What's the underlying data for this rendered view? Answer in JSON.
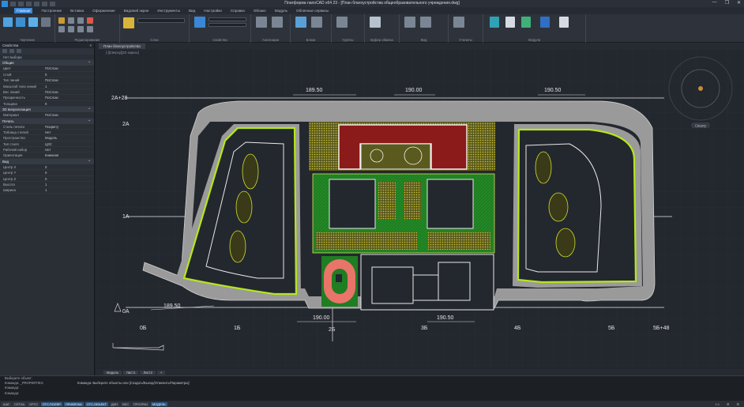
{
  "app": {
    "title": "Платформа nanoCAD x64 23 - [План благоустройства общеобразовательного учреждения.dwg]",
    "window_controls": [
      "—",
      "❐",
      "✕"
    ]
  },
  "ribbon_tabs": [
    "Главная",
    "Построение",
    "Вставка",
    "Оформление",
    "Видовой экран",
    "Инструменты",
    "Вид",
    "Настройки",
    "Справка",
    "Облако",
    "Модуль",
    "Облачные сервисы"
  ],
  "ribbon_groups": [
    "Черчение",
    "Редактирование",
    "Слои",
    "Свойства",
    "Аннотации",
    "Блоки",
    "Группы",
    "Буфер обмена",
    "Вид",
    "Утилиты",
    "Модули"
  ],
  "properties": {
    "panel_title": "Свойства",
    "selection": "Нет выбора",
    "sections": [
      {
        "title": "Общие",
        "rows": [
          [
            "Цвет",
            "ПоСлою"
          ],
          [
            "Слой",
            "0"
          ],
          [
            "Тип линий",
            "ПоСлою"
          ],
          [
            "Масштаб типа линий",
            "1"
          ],
          [
            "Вес линий",
            "ПоСлою"
          ],
          [
            "Прозрачность",
            "ПоСлою"
          ],
          [
            "Толщина",
            "0"
          ]
        ]
      },
      {
        "title": "3D визуализация",
        "rows": [
          [
            "Материал",
            "ПоСлою"
          ]
        ]
      },
      {
        "title": "Печать",
        "rows": [
          [
            "Стиль печати",
            "ПоЦвету"
          ],
          [
            "Таблица стилей",
            "Нет"
          ],
          [
            "Пространство",
            "Модель"
          ],
          [
            "Тип стиля",
            "ЦЗС"
          ],
          [
            "Рабочий набор",
            "Нет"
          ],
          [
            "Ориентация",
            "Книжная"
          ]
        ]
      },
      {
        "title": "Вид",
        "rows": [
          [
            "Центр X",
            "0"
          ],
          [
            "Центр Y",
            "0"
          ],
          [
            "Центр Z",
            "0"
          ],
          [
            "Высота",
            "1"
          ],
          [
            "Ширина",
            "1"
          ]
        ]
      }
    ]
  },
  "document_tab": "План благоустройства",
  "view_label": "[-][Сверху][2D каркас]",
  "drawing": {
    "row_labels": [
      "2А+28",
      "2А",
      "1А",
      "0А"
    ],
    "column_labels": [
      "0Б",
      "1Б",
      "2Б",
      "3Б",
      "4Б",
      "5Б",
      "5Б+48"
    ],
    "dimensions": [
      "189.50",
      "190.00",
      "190.50",
      "189.50",
      "190.00",
      "190.50"
    ],
    "colors": {
      "road": "#9a9a9a",
      "grass": "#b5e61d",
      "field": "#1e7b24",
      "building": "#8b1a1a",
      "track": "#e8746a",
      "sand": "#b8a624"
    }
  },
  "viewcube_label": "Сверху",
  "layout_tabs": [
    "Модель",
    "Лист1",
    "Лист2",
    "+"
  ],
  "command_lines": [
    "Выберите объект:",
    "Команда: _PROPERTIES",
    "Команда:",
    "Команда:"
  ],
  "command_input": "Команда: Выберите объекты или [Создать/Выход/Отменить/Параметры]:",
  "status_items": [
    "ШАГ",
    "СЕТКА",
    "ОРТО",
    "ОТС-ПОЛЯР",
    "ПРИВЯЗКА",
    "ОТС-ОБЪЕКТ",
    "ДИН",
    "ВЕС",
    "ПРОЗРАЧ",
    "МОДЕЛЬ"
  ],
  "status_on": [
    3,
    4,
    5,
    9
  ],
  "status_right": [
    "1:1",
    "⚙",
    "☰"
  ]
}
